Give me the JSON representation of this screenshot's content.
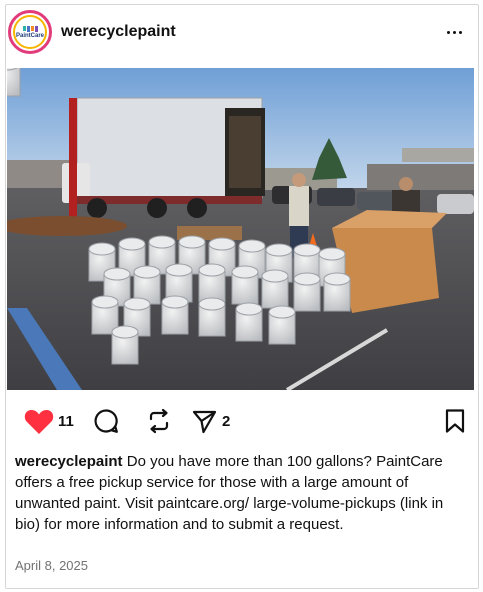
{
  "post": {
    "username": "werecyclepaint",
    "avatar_logo_text": "PaintCare",
    "likes": "11",
    "shares": "2",
    "caption_user": "werecyclepaint",
    "caption_text": "Do you have more than 100 gallons? PaintCare offers a free pickup service for those with a large amount of unwanted paint. Visit paintcare.org/ large-volume-pickups (link in bio) for more information and to submit a request.",
    "date": "April 8, 2025"
  },
  "icons": {
    "more": "more-options-icon",
    "like": "heart-icon",
    "comment": "comment-icon",
    "repost": "repost-icon",
    "share": "send-icon",
    "save": "bookmark-icon"
  },
  "colors": {
    "like_red": "#ff3040",
    "text": "#111111",
    "muted": "#737373",
    "border": "#d6d6d6"
  }
}
